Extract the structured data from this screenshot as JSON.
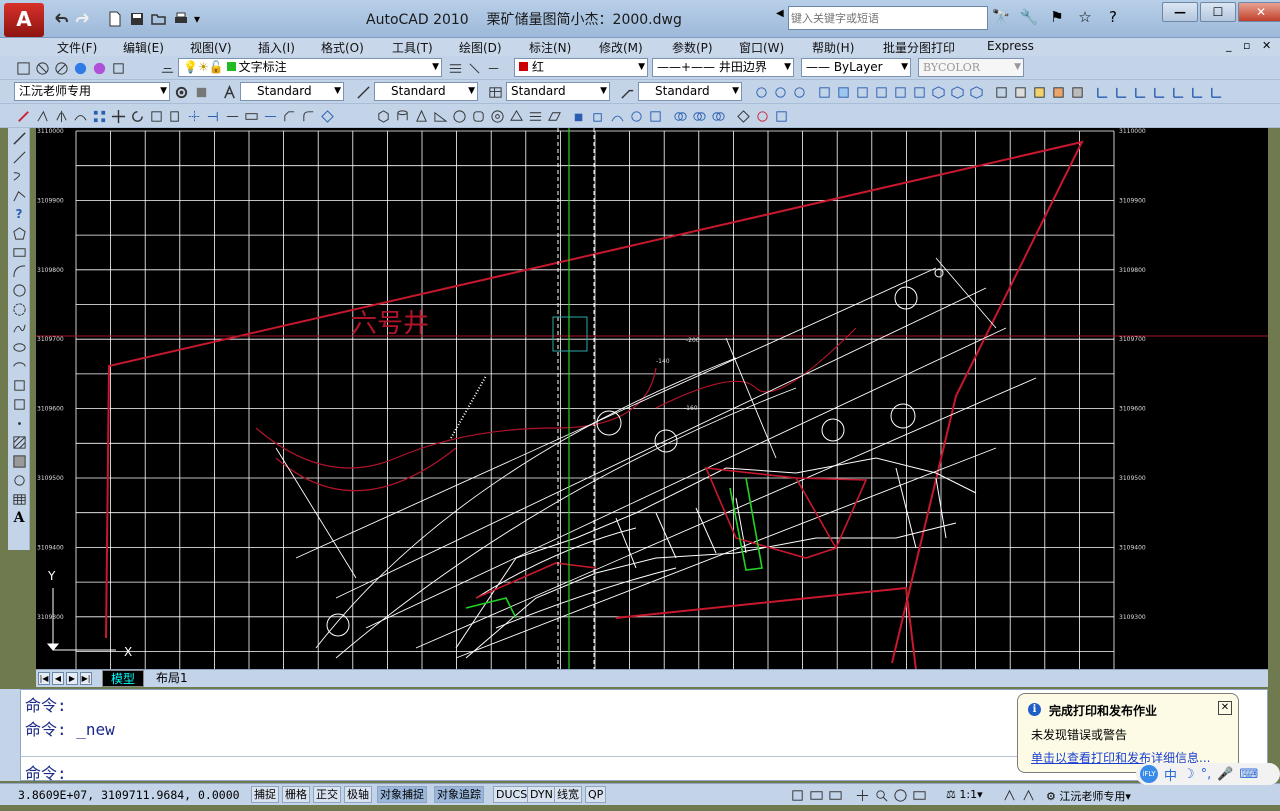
{
  "window": {
    "app_name": "AutoCAD 2010",
    "file_title": "栗矿储量图简小杰：2000.dwg",
    "search_placeholder": "键入关键字或短语",
    "logo_letter": "A",
    "minimize": "—",
    "maximize": "☐",
    "close": "✕"
  },
  "menu": {
    "items": [
      "文件(F)",
      "编辑(E)",
      "视图(V)",
      "插入(I)",
      "格式(O)",
      "工具(T)",
      "绘图(D)",
      "标注(N)",
      "修改(M)",
      "参数(P)",
      "窗口(W)",
      "帮助(H)",
      "批量分图打印",
      "Express"
    ],
    "doc_controls": "_ ▫ ✕"
  },
  "toolbar1": {
    "layer": "文字标注",
    "color": "红",
    "color_swatch": "#cc0000",
    "linetype": "——+—— 井田边界",
    "lineweight": "—— ByLayer",
    "plotstyle": "BYCOLOR"
  },
  "toolbar2": {
    "textstyle_combo": "江沅老师专用",
    "dimstyle": "Standard",
    "tablestyle": "Standard",
    "mleaderstyle": "Standard",
    "fourth_style": "Standard"
  },
  "drawing": {
    "label_well": "六号井",
    "y_ticks": [
      "3110000",
      "3109900",
      "3109800",
      "3109700",
      "3109600",
      "3109500",
      "3109400",
      "3109300"
    ],
    "contour_labels": [
      "-140",
      "-160",
      "-200"
    ],
    "ucs_x": "X",
    "ucs_y": "Y"
  },
  "tabs": {
    "model": "模型",
    "layout1": "布局1"
  },
  "command": {
    "line1": "命令:",
    "line2": "命令: _new",
    "prompt": "命令:"
  },
  "notification": {
    "title": "完成打印和发布作业",
    "message": "未发现错误或警告",
    "link": "单击以查看打印和发布详细信息..."
  },
  "status": {
    "coords": "3.8609E+07, 3109711.9684, 0.0000",
    "toggles": [
      "捕捉",
      "栅格",
      "正交",
      "极轴",
      "对象捕捉",
      "对象追踪",
      "DUCS",
      "DYN",
      "线宽",
      "QP"
    ],
    "scale": "1:1",
    "workspace": "江沅老师专用"
  },
  "ime": {
    "brand": "iFLY",
    "mode": "中"
  },
  "colors": {
    "canvas_bg": "#000000",
    "grid": "#ffffff",
    "red_lines": "#c8182d",
    "green_lines": "#22d422",
    "ui_blue": "#c3d3e8"
  }
}
